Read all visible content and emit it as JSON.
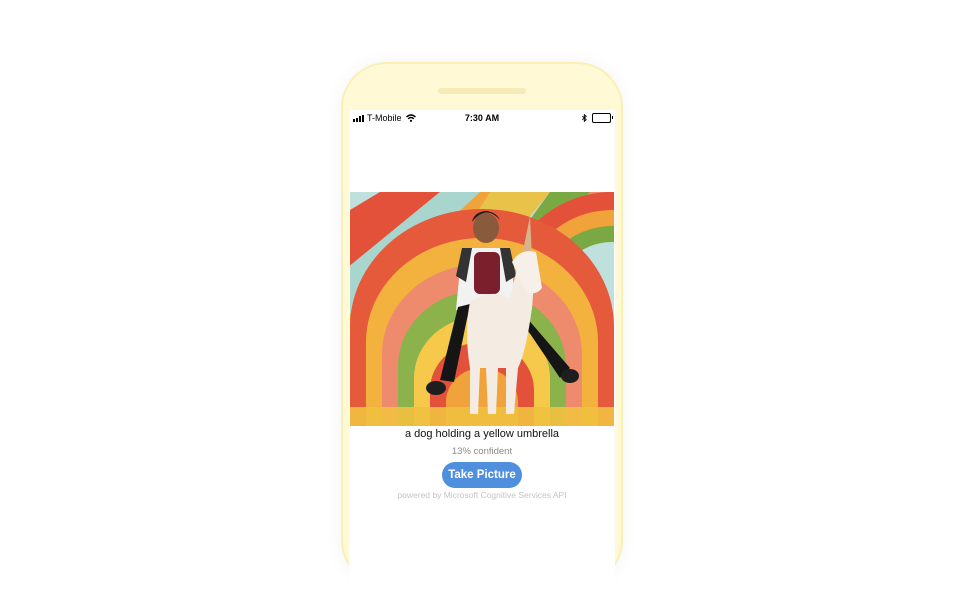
{
  "status_bar": {
    "carrier": "T-Mobile",
    "time": "7:30 AM",
    "icons": [
      "signal-icon",
      "wifi-icon",
      "bluetooth-icon",
      "battery-icon"
    ]
  },
  "photo": {
    "icon": "photo-of-person-riding-unicorn-statue"
  },
  "result": {
    "caption": "a dog holding a yellow umbrella",
    "confidence": "13% confident"
  },
  "actions": {
    "take_picture_label": "Take Picture"
  },
  "footer": {
    "powered_by": "powered by Microsoft Cognitive Services API"
  },
  "colors": {
    "accent": "#4f8fde",
    "device_frame": "#fff9d6",
    "caption_text": "#111111",
    "muted_text": "#8a8a8a",
    "footer_text": "#c4c4c4"
  }
}
